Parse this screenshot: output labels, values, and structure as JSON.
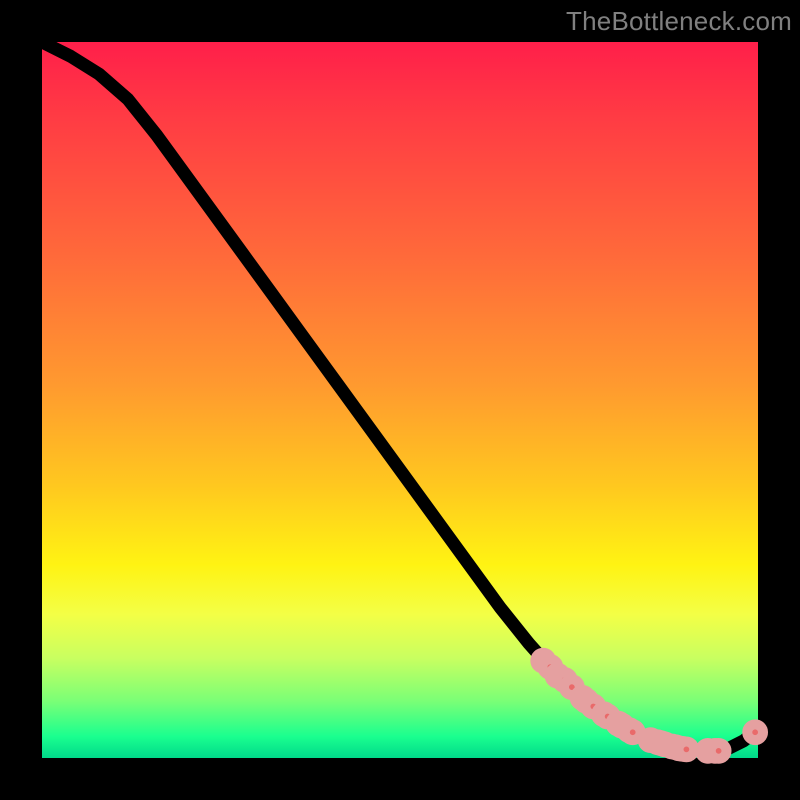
{
  "watermark": "TheBottleneck.com",
  "colors": {
    "gradient_top": "#ff1f4a",
    "gradient_mid": "#ffd022",
    "gradient_bottom": "#00d98a",
    "curve": "#000000",
    "marker_fill": "#e96a6a",
    "background": "#000000"
  },
  "chart_data": {
    "type": "line",
    "title": "",
    "xlabel": "",
    "ylabel": "",
    "xlim": [
      0,
      100
    ],
    "ylim": [
      0,
      100
    ],
    "series": [
      {
        "name": "curve",
        "x": [
          0,
          4,
          8,
          12,
          16,
          20,
          24,
          28,
          32,
          36,
          40,
          44,
          48,
          52,
          56,
          60,
          64,
          68,
          72,
          76,
          80,
          84,
          86,
          88,
          90,
          92,
          94,
          96,
          98,
          100
        ],
        "y": [
          100,
          98,
          95.5,
          92,
          87,
          81.5,
          76,
          70.5,
          65,
          59.5,
          54,
          48.5,
          43,
          37.5,
          32,
          26.5,
          21,
          16,
          11.5,
          8,
          5,
          3,
          2.2,
          1.6,
          1.2,
          1,
          1,
          1.4,
          2.4,
          4
        ]
      }
    ],
    "markers": {
      "r": 1.1,
      "points_x": [
        70,
        71,
        72,
        73,
        74,
        75.5,
        76,
        77,
        78.5,
        79,
        80.5,
        81,
        82,
        82.5,
        85,
        86,
        86.5,
        87,
        88,
        88.5,
        89,
        89.5,
        90,
        93,
        94,
        94.5,
        99.6
      ],
      "points_y": [
        13.6,
        12.7,
        11.5,
        10.9,
        9.9,
        8.4,
        8,
        7.2,
        6.1,
        5.8,
        4.8,
        4.5,
        3.9,
        3.6,
        2.5,
        2.2,
        2.05,
        1.9,
        1.6,
        1.5,
        1.35,
        1.28,
        1.2,
        1,
        1,
        1,
        3.6
      ]
    }
  }
}
